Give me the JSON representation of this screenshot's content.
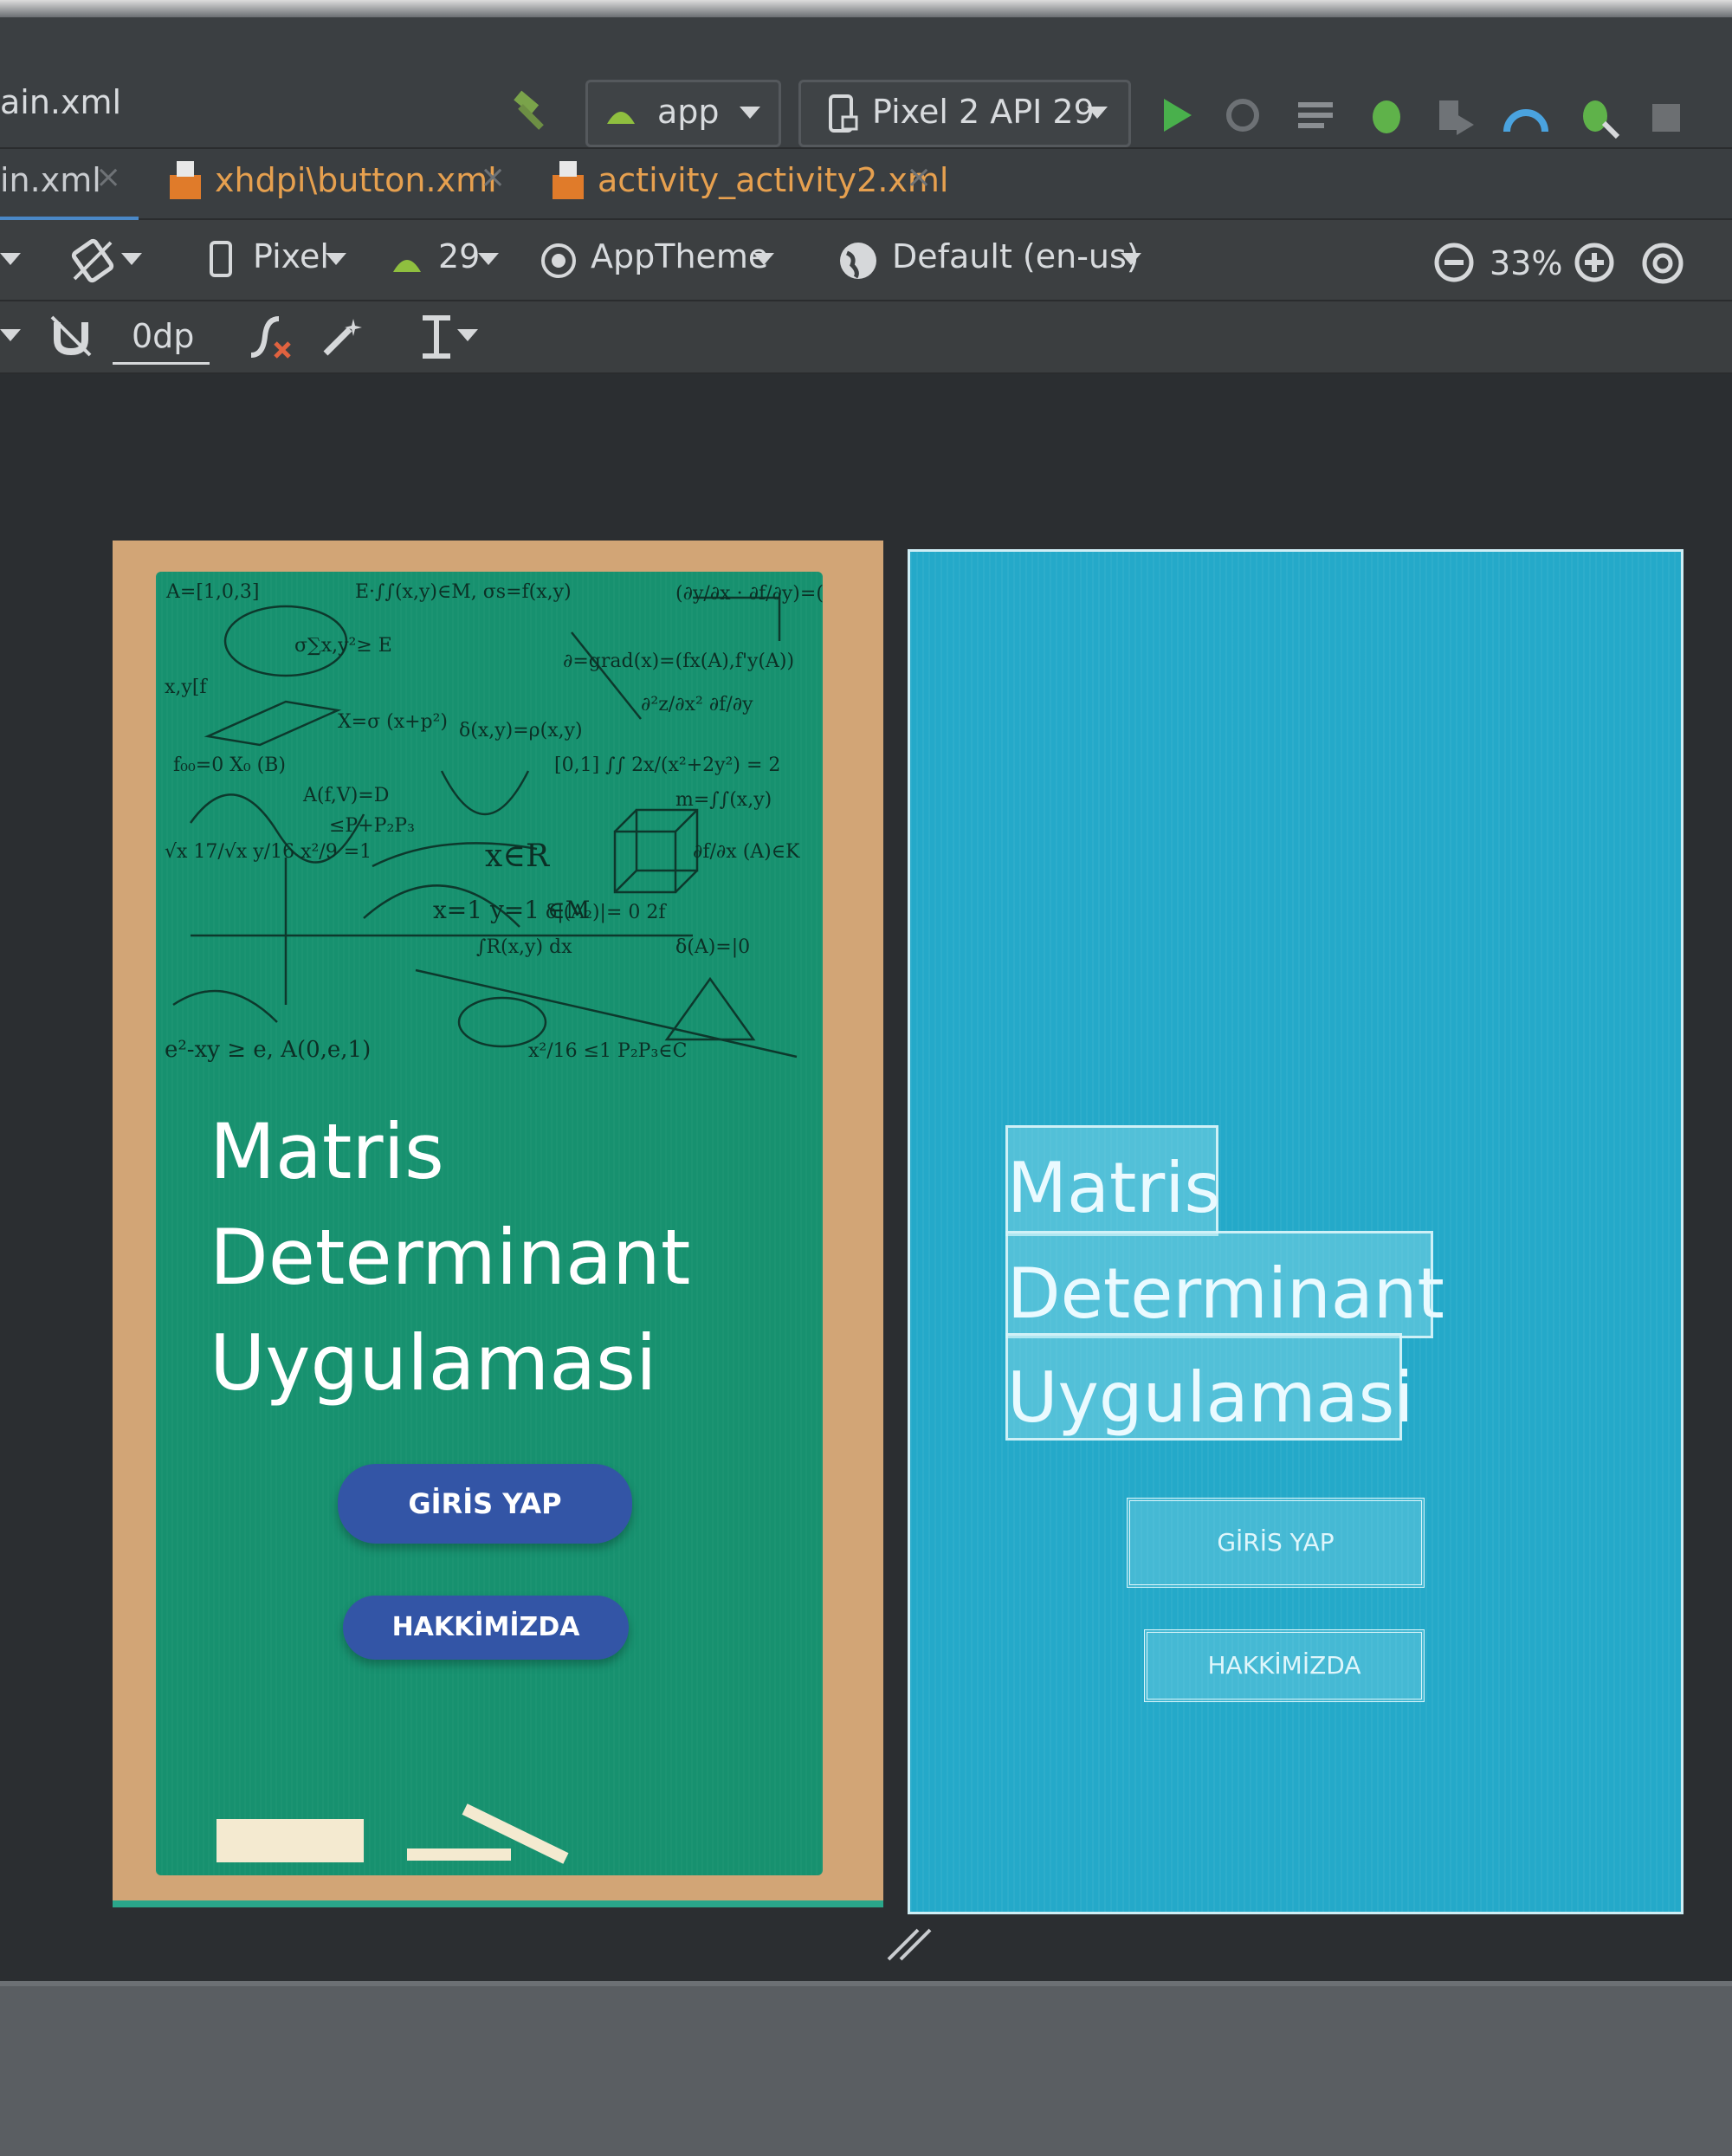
{
  "toolbar": {
    "file_name": "ain.xml",
    "module": "app",
    "device": "Pixel 2 API 29"
  },
  "tabs": [
    {
      "label": "in.xml",
      "active": true
    },
    {
      "label": "xhdpi\\button.xml",
      "active": false
    },
    {
      "label": "activity_activity2.xml",
      "active": false
    }
  ],
  "design_bar": {
    "device": "Pixel",
    "api": "29",
    "theme": "AppTheme",
    "locale": "Default (en-us)",
    "zoom": "33%"
  },
  "tools_bar": {
    "margin": "0dp"
  },
  "design_preview": {
    "title_line1": "Matris",
    "title_line2": "Determinant",
    "title_line3": "Uygulamasi",
    "login_button": "GİRİS YAP",
    "about_button": "HAKKİMİZDA"
  },
  "blueprint_preview": {
    "title_line1": "Matris",
    "title_line2": "Determinant",
    "title_line3": "Uygulamasi",
    "login_button": "GİRİS YAP",
    "about_button": "HAKKİMİZDA"
  },
  "colors": {
    "board": "#17916f",
    "frame": "#d2a576",
    "button": "#3355a6",
    "blueprint": "#24a9c9"
  }
}
